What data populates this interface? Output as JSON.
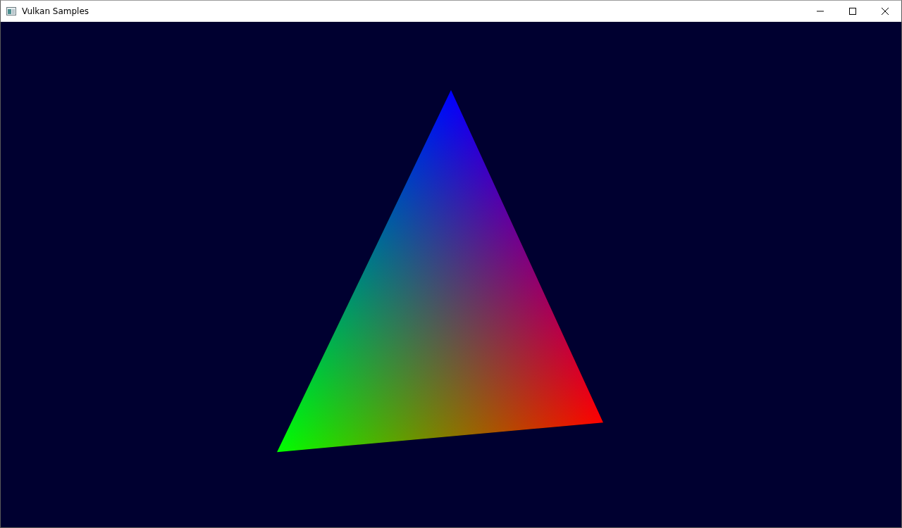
{
  "window": {
    "title": "Vulkan Samples"
  }
}
